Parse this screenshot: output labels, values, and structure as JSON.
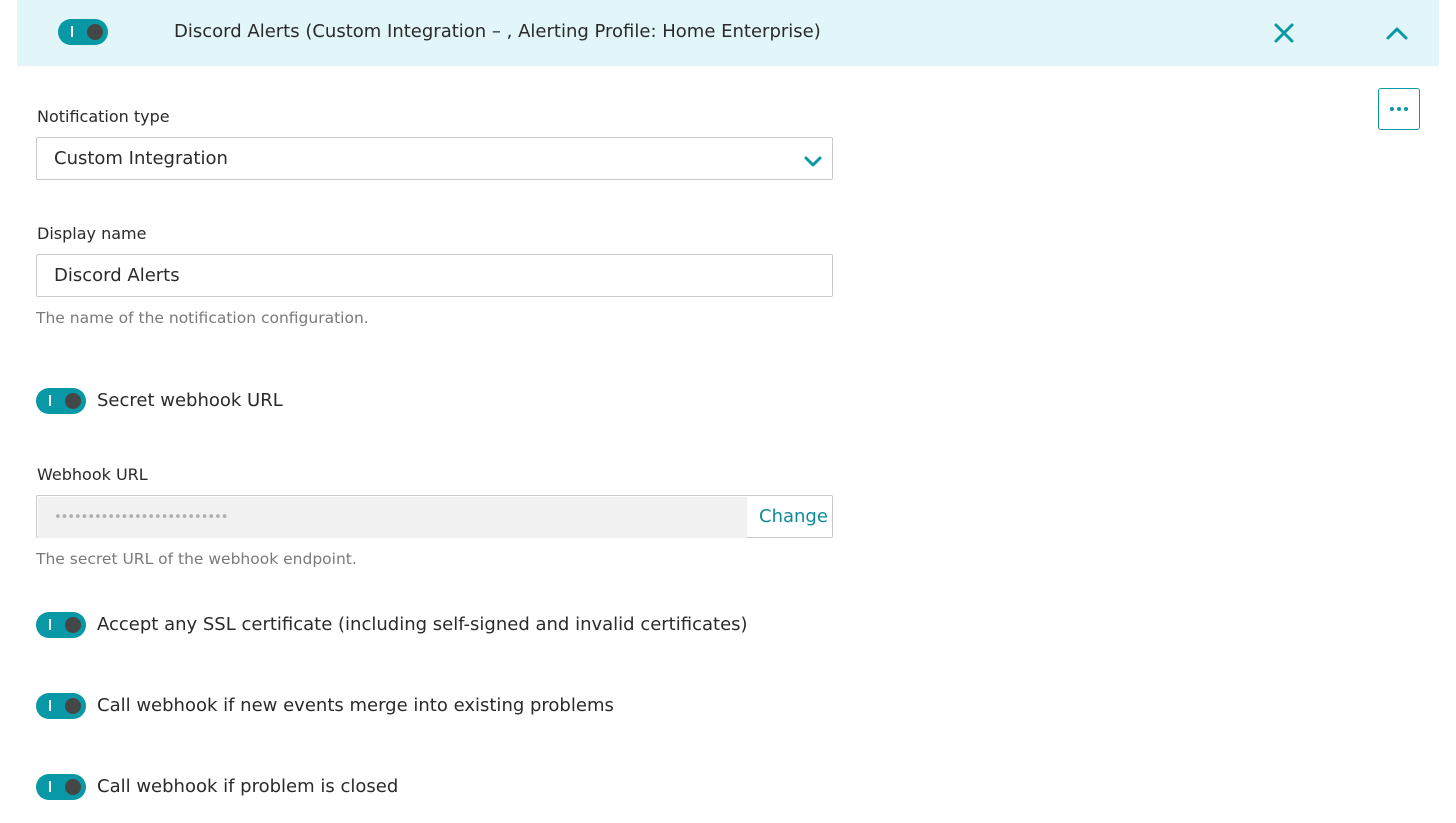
{
  "header": {
    "title": "Discord Alerts (Custom Integration – , Alerting Profile: Home Enterprise)",
    "enabled": true,
    "close_icon": "close-icon",
    "collapse_icon": "chevron-up-icon"
  },
  "more_menu_icon": "ellipsis-icon",
  "form": {
    "notification_type": {
      "label": "Notification type",
      "value": "Custom Integration",
      "dropdown_icon": "chevron-down-icon"
    },
    "display_name": {
      "label": "Display name",
      "value": "Discord Alerts",
      "hint": "The name of the notification configuration."
    },
    "secret_webhook": {
      "label": "Secret webhook URL",
      "enabled": true
    },
    "webhook_url": {
      "label": "Webhook URL",
      "masked_value": "••••••••••••••••••••••••••",
      "change_label": "Change",
      "hint": "The secret URL of the webhook endpoint."
    },
    "accept_ssl": {
      "label": "Accept any SSL certificate (including self-signed and invalid certificates)",
      "enabled": true
    },
    "merge_events": {
      "label": "Call webhook if new events merge into existing problems",
      "enabled": true
    },
    "problem_closed": {
      "label": "Call webhook if problem is closed",
      "enabled": true
    }
  },
  "colors": {
    "accent": "#0898a6",
    "header_bg": "#e2f6f9",
    "knob": "#454646"
  }
}
